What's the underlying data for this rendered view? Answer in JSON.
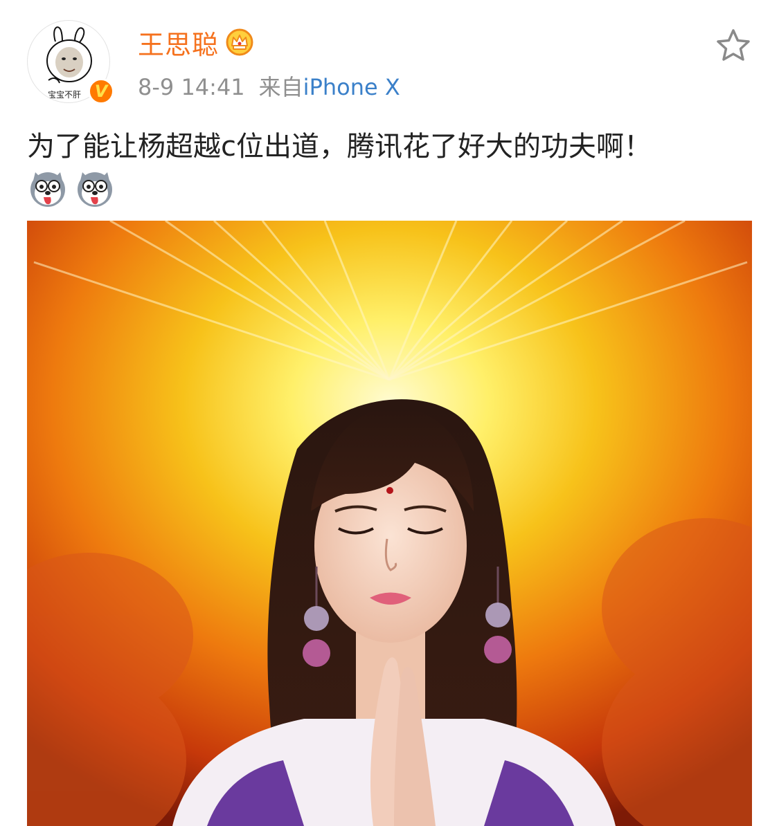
{
  "post": {
    "author": {
      "name": "王思聪",
      "avatar_caption": "宝宝不肝",
      "avatar_icon": "bunny-face-meme-avatar",
      "verified_badge": "V",
      "member_icon": "crown-icon"
    },
    "meta": {
      "time": "8-9 14:41",
      "from_label": "来自",
      "device": "iPhone X"
    },
    "actions": {
      "favorite_icon": "star-outline-icon"
    },
    "text": "为了能让杨超越c位出道，腾讯花了好大的功夫啊！",
    "emojis": [
      "husky-dog-emoji",
      "husky-dog-emoji"
    ],
    "photo": {
      "description_icon": "praying-girl-golden-light-photo"
    }
  },
  "colors": {
    "username": "#f5711d",
    "device_link": "#3b80c9",
    "meta_gray": "#8f8f8f",
    "body_text": "#222222",
    "verified_orange": "#ff7a00"
  }
}
